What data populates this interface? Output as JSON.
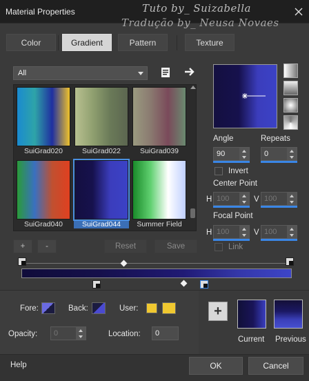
{
  "window": {
    "title": "Material Properties"
  },
  "watermark": {
    "line1": "Tuto by_ Suizabella",
    "line2": "Tradução by_ Neusa Novaes"
  },
  "tabs": [
    {
      "label": "Color",
      "active": false
    },
    {
      "label": "Gradient",
      "active": true
    },
    {
      "label": "Pattern",
      "active": false
    },
    {
      "label": "Texture",
      "active": false
    }
  ],
  "library": {
    "filter_value": "All",
    "items": [
      {
        "label": "SuiGrad020",
        "colors": [
          "#1a8ad0",
          "#2ea4a8",
          "#1f2fa0",
          "#f0c22a"
        ],
        "selected": false
      },
      {
        "label": "SuiGrad022",
        "colors": [
          "#b8c090",
          "#90a070",
          "#6a7a58",
          "#5c6650"
        ],
        "selected": false
      },
      {
        "label": "SuiGrad039",
        "colors": [
          "#9a9a80",
          "#8a7a70",
          "#7a4a5a",
          "#6a8a70"
        ],
        "selected": false
      },
      {
        "label": "SuiGrad040",
        "colors": [
          "#2a9a3a",
          "#3a70c0",
          "#c05030",
          "#e04020"
        ],
        "selected": false
      },
      {
        "label": "SuiGrad044",
        "colors": [
          "#141040",
          "#16114d",
          "#3b3dbc",
          "#3b42c6"
        ],
        "selected": true
      },
      {
        "label": "Summer Field",
        "colors": [
          "#1a8a2a",
          "#60d070",
          "#ffffff",
          "#c0d0ff"
        ],
        "selected": false
      }
    ],
    "buttons": {
      "add": "+",
      "remove": "-",
      "reset": "Reset",
      "save": "Save"
    }
  },
  "settings": {
    "angle_label": "Angle",
    "angle_value": "90",
    "repeats_label": "Repeats",
    "repeats_value": "0",
    "invert_label": "Invert",
    "center_label": "Center Point",
    "center_h_label": "H",
    "center_h": "100",
    "center_v_label": "V",
    "center_v": "100",
    "focal_label": "Focal Point",
    "focal_h_label": "H",
    "focal_h": "100",
    "focal_v_label": "V",
    "focal_v": "100",
    "link_label": "Link"
  },
  "editor": {
    "fore_label": "Fore:",
    "back_label": "Back:",
    "user_label": "User:",
    "opacity_label": "Opacity:",
    "opacity_value": "0",
    "location_label": "Location:",
    "location_value": "0",
    "user_color": "#f0c830"
  },
  "swatches": {
    "current_label": "Current",
    "previous_label": "Previous",
    "add": "+"
  },
  "footer": {
    "help": "Help",
    "ok": "OK",
    "cancel": "Cancel"
  }
}
